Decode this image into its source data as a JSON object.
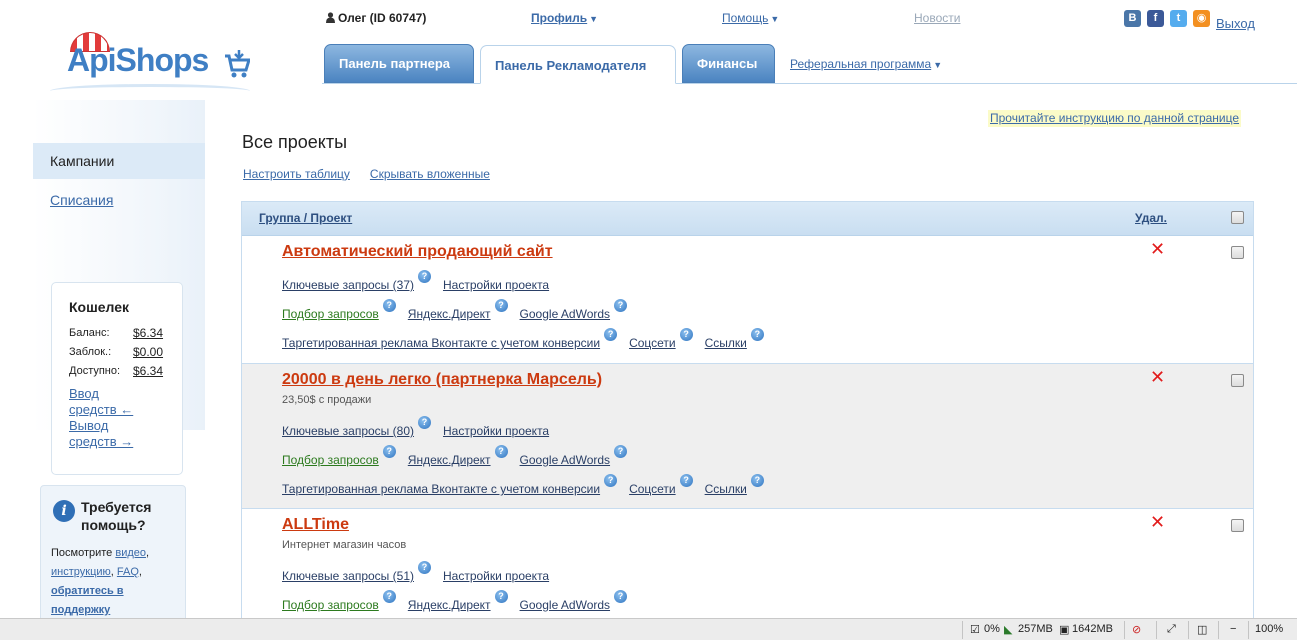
{
  "header": {
    "logo_text": "ApiShops",
    "user": "Олег (ID 60747)",
    "nav": [
      "Профиль",
      "Помощь",
      "Новости"
    ],
    "logout": "Выход",
    "social": [
      "vk-icon",
      "facebook-icon",
      "twitter-icon",
      "rss-icon"
    ]
  },
  "tabs": [
    {
      "label": "Панель партнера",
      "active": false
    },
    {
      "label": "Панель Рекламодателя",
      "active": true
    },
    {
      "label": "Финансы",
      "active": false
    }
  ],
  "referral": "Реферальная программа",
  "sidebar": {
    "items": [
      {
        "label": "Кампании",
        "active": true
      },
      {
        "label": "Списания",
        "active": false
      }
    ]
  },
  "wallet": {
    "title": "Кошелек",
    "rows": [
      {
        "label": "Баланс:",
        "value": "$6.34"
      },
      {
        "label": "Заблок.:",
        "value": "$0.00"
      },
      {
        "label": "Доступно:",
        "value": "$6.34"
      }
    ],
    "deposit_line1": "Ввод",
    "deposit_line2": "средств ←",
    "withdraw_line1": "Вывод",
    "withdraw_line2": "средств →"
  },
  "help": {
    "title_line1": "Требуется",
    "title_line2": "помощь?",
    "text_prefix": "Посмотрите",
    "video": "видео",
    "instruction": "инструкцию",
    "faq": "FAQ",
    "contact_line1": "обратитесь в",
    "contact_line2": "поддержку"
  },
  "main": {
    "instructions_link": "Прочитайте инструкцию по данной странице",
    "title": "Все проекты",
    "configure": "Настроить таблицу",
    "hide_nested": "Скрывать вложенные",
    "col_group": "Группа / Проект",
    "col_delete": "Удал."
  },
  "projects": [
    {
      "title": "Автоматический продающий сайт",
      "subtitle": "",
      "keywords": "Ключевые запросы (37)",
      "settings": "Настройки проекта",
      "selection": "Подбор запросов",
      "yandex": "Яндекс.Директ",
      "adwords": "Google AdWords",
      "vk": "Таргетированная реклама Вконтакте с учетом конверсии",
      "social": "Соцсети",
      "links": "Ссылки"
    },
    {
      "title": "20000 в день легко (партнерка Марсель)",
      "subtitle": "23,50$ с продажи",
      "keywords": "Ключевые запросы (80)",
      "settings": "Настройки проекта",
      "selection": "Подбор запросов",
      "yandex": "Яндекс.Директ",
      "adwords": "Google AdWords",
      "vk": "Таргетированная реклама Вконтакте с учетом конверсии",
      "social": "Соцсети",
      "links": "Ссылки"
    },
    {
      "title": "ALLTime",
      "subtitle": "Интернет магазин часов",
      "keywords": "Ключевые запросы (51)",
      "settings": "Настройки проекта",
      "selection": "Подбор запросов",
      "yandex": "Яндекс.Директ",
      "adwords": "Google AdWords"
    }
  ],
  "statusbar": {
    "cpu": "0%",
    "mem1": "257MB",
    "mem2": "1642MB",
    "zoom": "100%"
  }
}
